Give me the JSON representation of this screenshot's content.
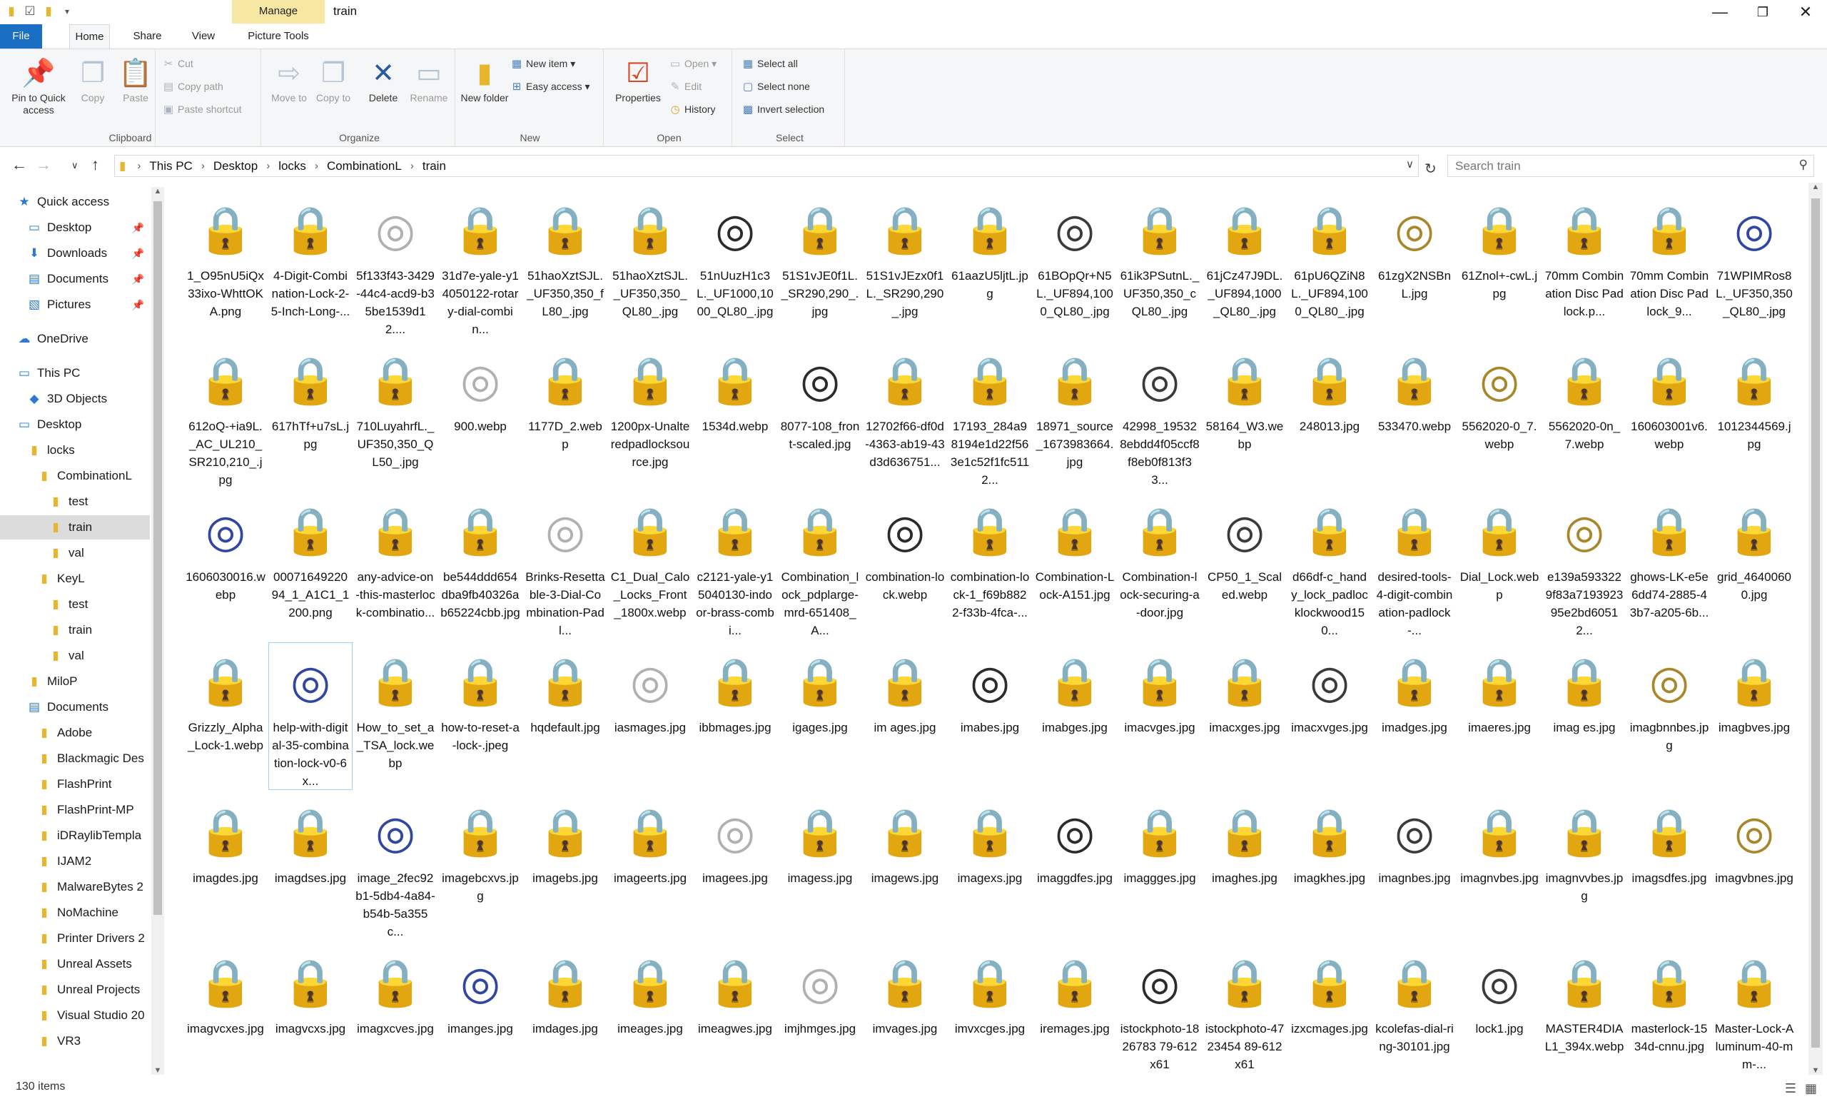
{
  "window": {
    "title": "train",
    "manage_tab": "Manage"
  },
  "tabs": {
    "file": "File",
    "home": "Home",
    "share": "Share",
    "view": "View",
    "picture_tools": "Picture Tools"
  },
  "ribbon": {
    "clipboard": {
      "label": "Clipboard",
      "pin": "Pin to Quick access",
      "copy": "Copy",
      "paste": "Paste",
      "cut": "Cut",
      "copy_path": "Copy path",
      "paste_shortcut": "Paste shortcut"
    },
    "organize": {
      "label": "Organize",
      "move_to": "Move to",
      "copy_to": "Copy to",
      "delete": "Delete",
      "rename": "Rename"
    },
    "new": {
      "label": "New",
      "new_folder": "New folder",
      "new_item": "New item ▾",
      "easy_access": "Easy access ▾"
    },
    "open": {
      "label": "Open",
      "properties": "Properties",
      "open": "Open ▾",
      "edit": "Edit",
      "history": "History"
    },
    "select": {
      "label": "Select",
      "select_all": "Select all",
      "select_none": "Select none",
      "invert": "Invert selection"
    }
  },
  "address": {
    "crumbs": [
      "This PC",
      "Desktop",
      "locks",
      "CombinationL",
      "train"
    ],
    "search_placeholder": "Search train"
  },
  "navpane": [
    {
      "label": "Quick access",
      "icon": "star-icon",
      "pinned": false
    },
    {
      "label": "Desktop",
      "icon": "desktop-icon",
      "pinned": true
    },
    {
      "label": "Downloads",
      "icon": "download-icon",
      "pinned": true
    },
    {
      "label": "Documents",
      "icon": "documents-icon",
      "pinned": true
    },
    {
      "label": "Pictures",
      "icon": "pictures-icon",
      "pinned": true
    },
    {
      "label": "OneDrive",
      "icon": "cloud-icon",
      "pinned": false
    },
    {
      "label": "This PC",
      "icon": "computer-icon",
      "pinned": false
    },
    {
      "label": "3D Objects",
      "icon": "cube-icon",
      "pinned": false
    },
    {
      "label": "Desktop",
      "icon": "desktop-icon",
      "pinned": false
    },
    {
      "label": "locks",
      "icon": "folder-icon",
      "pinned": false
    },
    {
      "label": "CombinationL",
      "icon": "folder-icon",
      "pinned": false
    },
    {
      "label": "test",
      "icon": "folder-icon",
      "pinned": false
    },
    {
      "label": "train",
      "icon": "folder-icon",
      "pinned": false
    },
    {
      "label": "val",
      "icon": "folder-icon",
      "pinned": false
    },
    {
      "label": "KeyL",
      "icon": "folder-icon",
      "pinned": false
    },
    {
      "label": "test",
      "icon": "folder-icon",
      "pinned": false
    },
    {
      "label": "train",
      "icon": "folder-icon",
      "pinned": false
    },
    {
      "label": "val",
      "icon": "folder-icon",
      "pinned": false
    },
    {
      "label": "MiloP",
      "icon": "folder-icon",
      "pinned": false
    },
    {
      "label": "Documents",
      "icon": "documents-icon",
      "pinned": false
    },
    {
      "label": "Adobe",
      "icon": "folder-icon",
      "pinned": false
    },
    {
      "label": "Blackmagic Des",
      "icon": "folder-icon",
      "pinned": false
    },
    {
      "label": "FlashPrint",
      "icon": "folder-icon",
      "pinned": false
    },
    {
      "label": "FlashPrint-MP",
      "icon": "folder-icon",
      "pinned": false
    },
    {
      "label": "iDRaylibTempla",
      "icon": "folder-icon",
      "pinned": false
    },
    {
      "label": "IJAM2",
      "icon": "folder-icon",
      "pinned": false
    },
    {
      "label": "MalwareBytes 2",
      "icon": "folder-icon",
      "pinned": false
    },
    {
      "label": "NoMachine",
      "icon": "folder-icon",
      "pinned": false
    },
    {
      "label": "Printer Drivers 2",
      "icon": "folder-icon",
      "pinned": false
    },
    {
      "label": "Unreal Assets",
      "icon": "folder-icon",
      "pinned": false
    },
    {
      "label": "Unreal Projects",
      "icon": "folder-icon",
      "pinned": false
    },
    {
      "label": "Visual Studio 20",
      "icon": "folder-icon",
      "pinned": false
    },
    {
      "label": "VR3",
      "icon": "folder-icon",
      "pinned": false
    }
  ],
  "files": [
    [
      "1_O95nU5iQx33ixo-WhttOKA.png",
      "4-Digit-Combination-Lock-2-5-Inch-Long-...",
      "5f133f43-3429-44c4-acd9-b35be1539d12....",
      "31d7e-yale-y14050122-rotary-dial-combin...",
      "51haoXztSJL._UF350,350_fL80_.jpg",
      "51haoXztSJL._UF350,350_QL80_.jpg",
      "51nUuzH1c3L._UF1000,1000_QL80_.jpg",
      "51S1vJE0f1L._SR290,290_.jpg",
      "51S1vJEzx0f1L._SR290,290_.jpg",
      "61aazU5ljtL.jpg",
      "61BOpQr+N5L._UF894,1000_QL80_.jpg",
      "61ik3PSutnL._UF350,350_cQL80_.jpg",
      "61jCz47J9DL._UF894,1000_QL80_.jpg",
      "61pU6QZiN8L._UF894,1000_QL80_.jpg",
      "61zgX2NSBnL.jpg",
      "61Znol+-cwL.jpg",
      "70mm Combination Disc Padlock.p...",
      "70mm Combination Disc Padlock_9...",
      "71WPIMRos8L._UF350,350_QL80_.jpg"
    ],
    [
      "612oQ-+ia9L._AC_UL210_SR210,210_.jpg",
      "617hTf+u7sL.jpg",
      "710LuyahrfL._UF350,350_QL50_.jpg",
      "900.webp",
      "1177D_2.webp",
      "1200px-Unalteredpadlocksource.jpg",
      "1534d.webp",
      "8077-108_front-scaled.jpg",
      "12702f66-df0d-4363-ab19-43d3d636751...",
      "17193_284a98194e1d22f563e1c52f1fc5112...",
      "18971_source_1673983664.jpg",
      "42998_195328ebdd4f05ccf8f8eb0f813f33...",
      "58164_W3.webp",
      "248013.jpg",
      "533470.webp",
      "5562020-0_7.webp",
      "5562020-0n_7.webp",
      "160603001v6.webp",
      "1012344569.jpg"
    ],
    [
      "1606030016.webp",
      "0007164922094_1_A1C1_1200.png",
      "any-advice-on-this-masterlock-combinatio...",
      "be544ddd654dba9fb40326ab65224cbb.jpg",
      "Brinks-Resettable-3-Dial-Combination-Padl...",
      "C1_Dual_Calo_Locks_Front_1800x.webp",
      "c2121-yale-y15040130-indoor-brass-combi...",
      "Combination_lock_pdplarge-mrd-651408_A...",
      "combination-lock.webp",
      "combination-lock-1_f69b8822-f33b-4fca-...",
      "Combination-Lock-A151.jpg",
      "Combination-lock-securing-a-door.jpg",
      "CP50_1_Scaled.webp",
      "d66df-c_handy_lock_padlocklockwood150...",
      "desired-tools-4-digit-combination-padlock-...",
      "Dial_Lock.webp",
      "e139a5933229f83a719392395e2bd60512...",
      "ghows-LK-e5e6dd74-2885-43b7-a205-6b...",
      "grid_46400600.jpg"
    ],
    [
      "Grizzly_Alpha_Lock-1.webp",
      "help-with-digital-35-combination-lock-v0-6x...",
      "How_to_set_a_TSA_lock.webp",
      "how-to-reset-a-lock-.jpeg",
      "hqdefault.jpg",
      "iasmages.jpg",
      "ibbmages.jpg",
      "igages.jpg",
      "im ages.jpg",
      "imabes.jpg",
      "imabges.jpg",
      "imacvges.jpg",
      "imacxges.jpg",
      "imacxvges.jpg",
      "imadges.jpg",
      "imaeres.jpg",
      "imag es.jpg",
      "imagbnnbes.jpg",
      "imagbves.jpg"
    ],
    [
      "imagdes.jpg",
      "imagdses.jpg",
      "image_2fec92b1-5db4-4a84-b54b-5a355c...",
      "imagebcxvs.jpg",
      "imagebs.jpg",
      "imageerts.jpg",
      "imagees.jpg",
      "imagess.jpg",
      "imagews.jpg",
      "imagexs.jpg",
      "imaggdfes.jpg",
      "imaggges.jpg",
      "imaghes.jpg",
      "imagkhes.jpg",
      "imagnbes.jpg",
      "imagnvbes.jpg",
      "imagnvvbes.jpg",
      "imagsdfes.jpg",
      "imagvbnes.jpg"
    ],
    [
      "imagvcxes.jpg",
      "imagvcxs.jpg",
      "imagxcves.jpg",
      "imanges.jpg",
      "imdages.jpg",
      "imeages.jpg",
      "imeagwes.jpg",
      "imjhmges.jpg",
      "imvages.jpg",
      "imvxcges.jpg",
      "iremages.jpg",
      "istockphoto-1826783 79-612x61",
      "istockphoto-4723454 89-612x61",
      "izxcmages.jpg",
      "kcolefas-dial-ring-30101.jpg",
      "lock1.jpg",
      "MASTER4DIAL1_394x.webp",
      "masterlock-1534d-cnnu.jpg",
      "Master-Lock-Aluminum-40-mm-..."
    ]
  ],
  "selected_file": "help-with-digital-35-combination-lock-v0-6x...",
  "status": {
    "count": "130 items"
  },
  "colors": {
    "accent": "#1a6fc4",
    "manage_tab": "#f6e7a3",
    "folder": "#e8b62c",
    "selection": "#dcdcdc"
  }
}
